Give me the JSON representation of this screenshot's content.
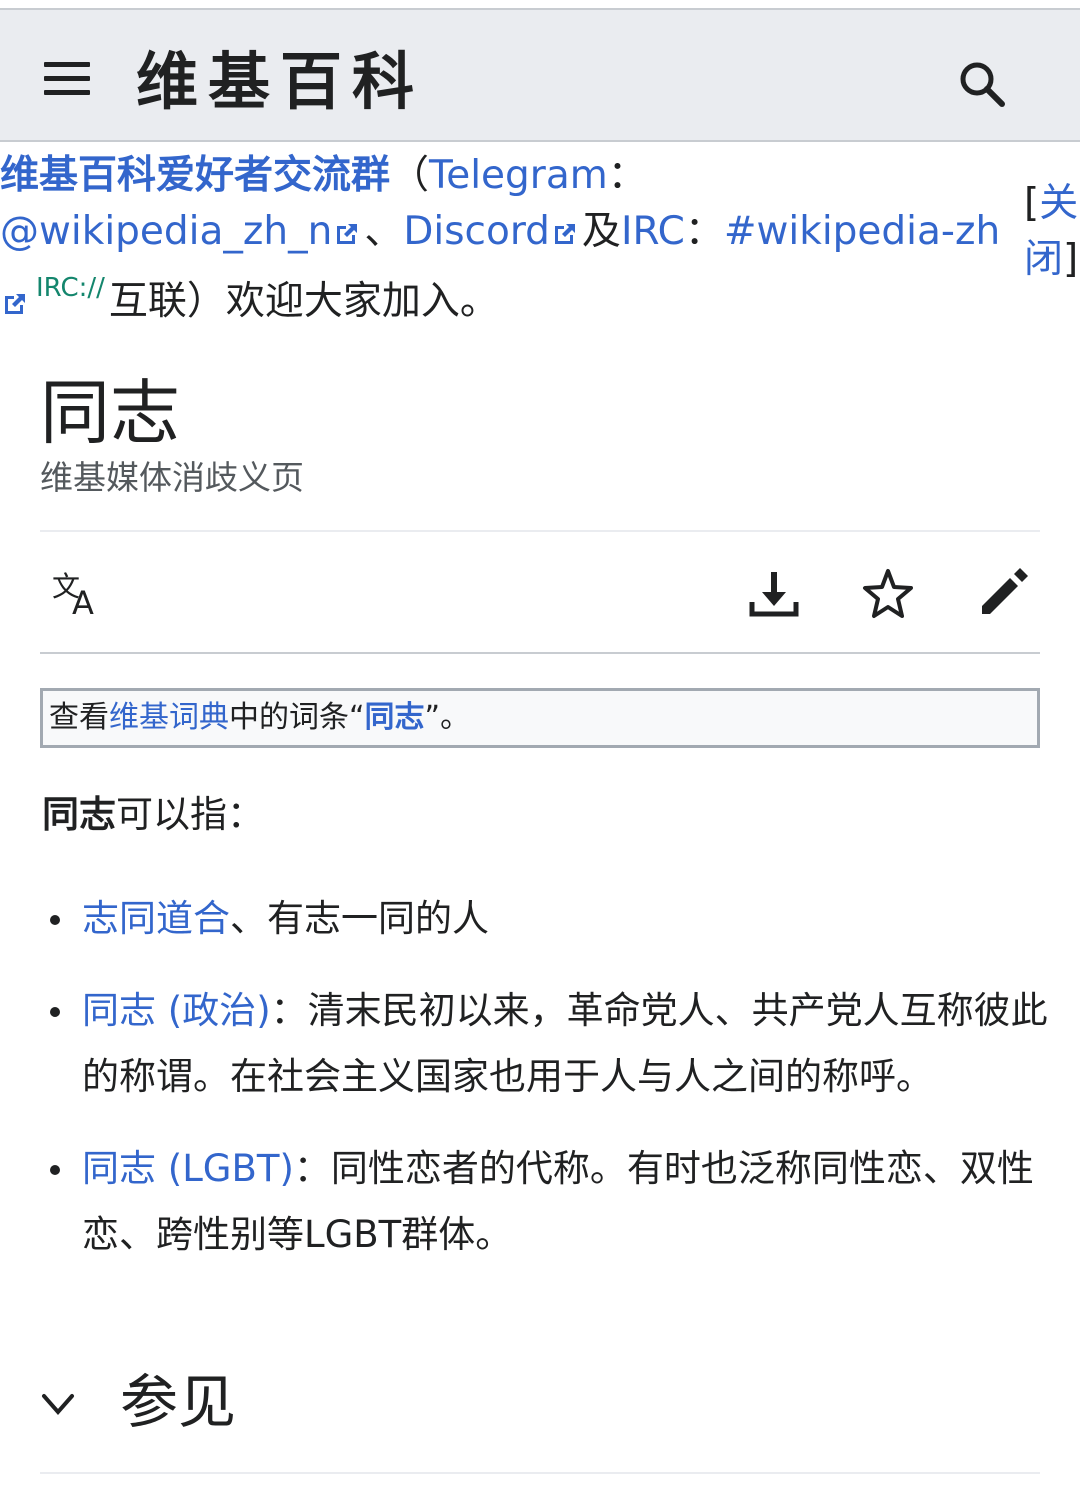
{
  "header": {
    "wordmark": "维基百科",
    "menu_icon": "hamburger-menu-icon",
    "search_icon": "search-icon"
  },
  "sitenotice": {
    "group_link": "维基百科爱好者交流群",
    "paren_open": "（",
    "telegram_label": "Telegram",
    "colon1": "：",
    "telegram_handle": "@wikipedia_zh_n",
    "sep1": "、",
    "discord": "Discord",
    "and_irc": "及",
    "irc_label": "IRC",
    "colon2": "：",
    "irc_channel": "#wikipedia-zh",
    "irc_protocol": "IRC://",
    "tail": "互联）欢迎大家加入。",
    "close_text_open": "[",
    "close_link": "关闭",
    "close_text_close": "]"
  },
  "page": {
    "title": "同志",
    "subtitle": "维基媒体消歧义页"
  },
  "toolbar": {
    "language_icon": "language-icon",
    "download_icon": "download-icon",
    "watch_icon": "star-icon",
    "edit_icon": "pencil-edit-icon"
  },
  "dictbox": {
    "prefix": "查看",
    "link": "维基词典",
    "middle": "中的词条“",
    "term": "同志",
    "suffix": "”。"
  },
  "intro": {
    "bold": "同志",
    "rest": "可以指："
  },
  "items": [
    {
      "link": "志同道合",
      "text": "、有志一同的人"
    },
    {
      "link": "同志 (政治)",
      "text": "：清末民初以来，革命党人、共产党人互称彼此的称谓。在社会主义国家也用于人与人之间的称呼。"
    },
    {
      "link": "同志 (LGBT)",
      "text": "：同性恋者的代称。有时也泛称同性恋、双性恋、跨性别等LGBT群体。"
    }
  ],
  "section": {
    "heading": "参见",
    "chevron_icon": "chevron-down-icon"
  },
  "colors": {
    "link": "#3366cc",
    "header_bg": "#eaecf0",
    "text": "#202122",
    "external_protocol": "#14866d"
  }
}
